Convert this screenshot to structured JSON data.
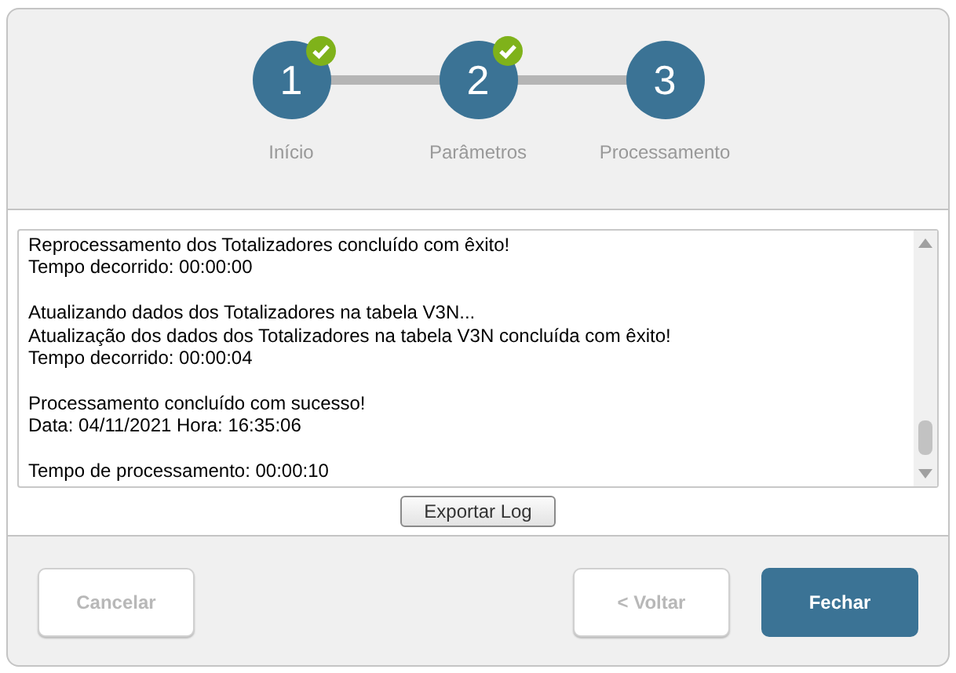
{
  "steps": [
    {
      "number": "1",
      "label": "Início",
      "completed": true
    },
    {
      "number": "2",
      "label": "Parâmetros",
      "completed": true
    },
    {
      "number": "3",
      "label": "Processamento",
      "completed": false
    }
  ],
  "log": {
    "paragraphs": [
      [
        "Reprocessamento dos Totalizadores concluído com êxito!",
        "Tempo decorrido: 00:00:00"
      ],
      [
        "Atualizando dados dos Totalizadores na tabela V3N...",
        "Atualização dos dados dos Totalizadores na tabela V3N concluída com êxito!",
        "Tempo decorrido: 00:00:04"
      ],
      [
        "Processamento concluído com sucesso!",
        "Data: 04/11/2021 Hora: 16:35:06"
      ],
      [
        "Tempo de processamento: 00:00:10"
      ]
    ]
  },
  "export_button": "Exportar Log",
  "buttons": [
    {
      "label": "Cancelar",
      "kind": "default",
      "disabled": true
    },
    {
      "label": "< Voltar",
      "kind": "default",
      "disabled": true
    },
    {
      "label": "Fechar",
      "kind": "primary",
      "disabled": false
    }
  ]
}
